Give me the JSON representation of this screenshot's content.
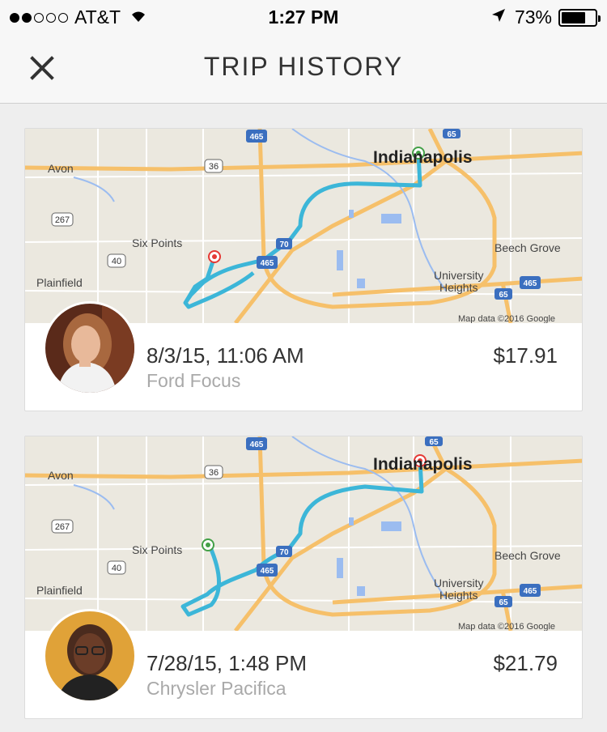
{
  "status_bar": {
    "carrier": "AT&T",
    "time": "1:27 PM",
    "battery": "73%",
    "battery_level": 0.73,
    "signal_bars": 2
  },
  "nav": {
    "title": "TRIP HISTORY",
    "close_icon": "close-icon"
  },
  "trips": [
    {
      "date": "8/3/15, 11:06 AM",
      "car": "Ford Focus",
      "price": "$17.91",
      "map": {
        "labels": [
          "Avon",
          "Indianapolis",
          "Six Points",
          "Plainfield",
          "Beech Grove",
          "University",
          "Heights"
        ],
        "shields": [
          "465",
          "465",
          "465",
          "65",
          "65",
          "36",
          "267",
          "40",
          "70"
        ],
        "credit": "Map data ©2016 Google"
      }
    },
    {
      "date": "7/28/15, 1:48 PM",
      "car": "Chrysler Pacifica",
      "price": "$21.79",
      "map": {
        "labels": [
          "Avon",
          "Indianapolis",
          "Six Points",
          "Plainfield",
          "Beech Grove",
          "University",
          "Heights"
        ],
        "shields": [
          "465",
          "465",
          "465",
          "65",
          "65",
          "36",
          "267",
          "40",
          "70"
        ],
        "credit": "Map data ©2016 Google"
      }
    }
  ],
  "colors": {
    "route": "#3cb6d8",
    "highway": "#f6c06a",
    "map_bg": "#ebe8df",
    "pickup": "#43a047",
    "dropoff": "#e53935"
  }
}
